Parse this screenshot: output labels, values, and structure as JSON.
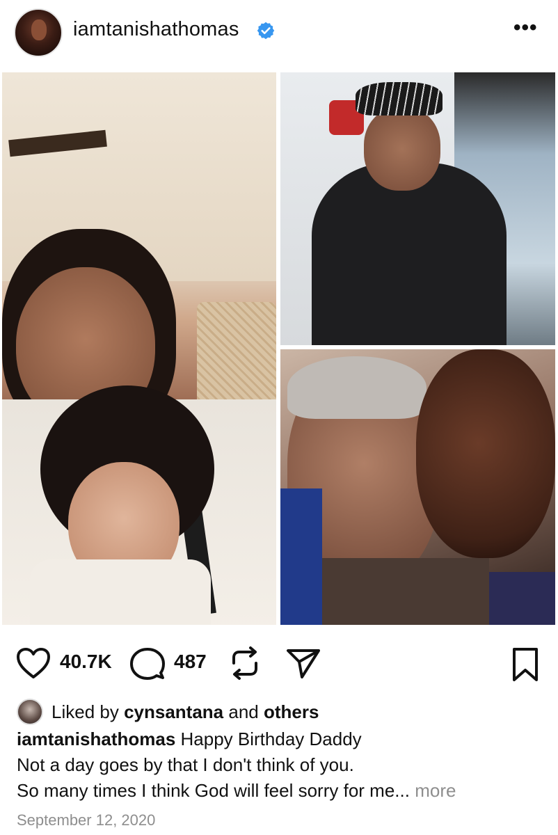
{
  "post": {
    "username": "iamtanishathomas",
    "verified": true,
    "more_menu": "•••"
  },
  "media": {
    "photos": [
      "photo-1",
      "photo-2",
      "photo-3"
    ]
  },
  "actions": {
    "likes": "40.7K",
    "comments": "487",
    "icons": [
      "heart-icon",
      "comment-icon",
      "repost-icon",
      "share-icon",
      "bookmark-icon"
    ]
  },
  "liked_by": {
    "prefix": "Liked by ",
    "user": "cynsantana",
    "middle": " and ",
    "others": "others"
  },
  "caption": {
    "username": "iamtanishathomas",
    "line1": " Happy Birthday Daddy",
    "line2": "Not a day goes by that I don't think of you.",
    "line3": "So many times I think God will feel sorry for me...",
    "more": "more"
  },
  "date": "September 12, 2020",
  "colors": {
    "verified_blue": "#3897f0",
    "muted": "#8e8e8e"
  }
}
